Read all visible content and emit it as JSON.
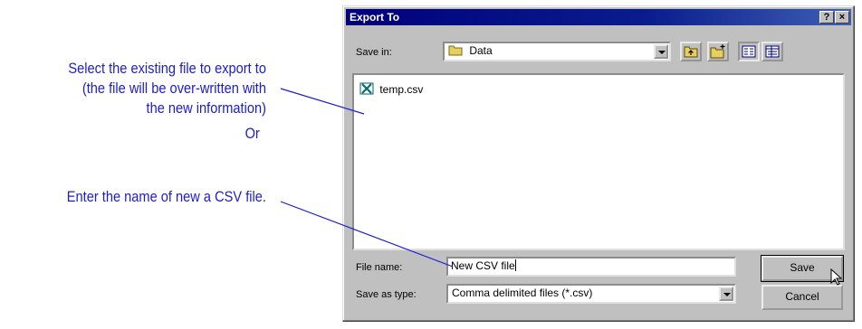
{
  "annotations": {
    "select_line1": "Select the existing file to export to",
    "select_line2": "(the file will be over-written with",
    "select_line3": "the new information)",
    "or": "Or",
    "enter": "Enter the name of new a CSV file."
  },
  "dialog": {
    "title": "Export To",
    "help_icon": "question-icon",
    "close_icon": "close-icon",
    "save_in_label": "Save in:",
    "save_in_value": "Data",
    "toolbar_icons": [
      "up-one-level-icon",
      "new-folder-icon",
      "list-view-icon",
      "details-view-icon"
    ],
    "files": [
      {
        "name": "temp.csv",
        "icon": "excel-csv-file-icon"
      }
    ],
    "file_name_label": "File name:",
    "file_name_value": "New CSV file",
    "save_as_type_label": "Save as type:",
    "save_as_type_value": "Comma delimited files (*.csv)",
    "save_button": "Save",
    "cancel_button": "Cancel"
  },
  "colors": {
    "annotation": "#1c1cd2",
    "titlebar": "#00007c",
    "dialog_bg": "#c0c0c0"
  }
}
